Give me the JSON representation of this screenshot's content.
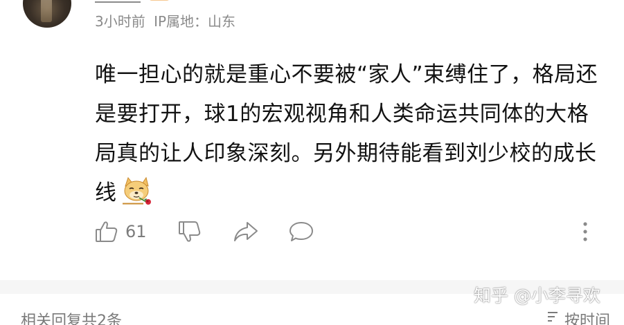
{
  "comment": {
    "meta": {
      "time": "3小时前",
      "ip_location": "IP属地：山东"
    },
    "text": "唯一担心的就是重心不要被“家人”束缚住了，格局还是要打开，球1的宏观视角和人类命运共同体的大格局真的让人印象深刻。另外期待能看到刘少校的成长线",
    "emoji_icon": "doge-with-rose-icon",
    "likes": "61"
  },
  "actions": {
    "like_icon": "thumbs-up-icon",
    "dislike_icon": "thumbs-down-icon",
    "share_icon": "share-icon",
    "reply_icon": "comment-bubble-icon",
    "more_icon": "more-vertical-icon"
  },
  "footer": {
    "left_text": "相关回复共2条",
    "right_text": "按时间",
    "sort_icon": "sort-icon"
  },
  "watermark": "知乎 @小李寻欢",
  "colors": {
    "meta_gray": "#8a8a8a",
    "text": "#121212",
    "divider_bg": "#f6f6f6"
  }
}
